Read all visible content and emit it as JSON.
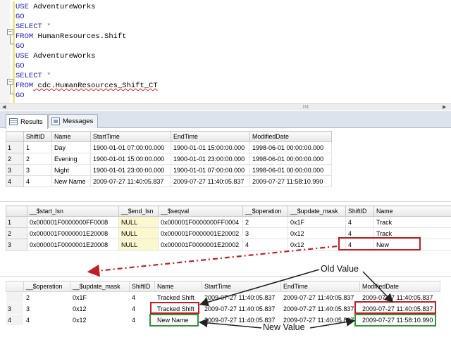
{
  "editor": {
    "lines": [
      {
        "kw": "USE",
        "rest": " AdventureWorks"
      },
      {
        "kw": "GO",
        "rest": ""
      },
      {
        "kw": "SELECT",
        "rest": " *",
        "rest_gray": true
      },
      {
        "kw": "FROM",
        "rest": " HumanResources.Shift"
      },
      {
        "kw": "GO",
        "rest": ""
      },
      {
        "kw": "USE",
        "rest": " AdventureWorks"
      },
      {
        "kw": "GO",
        "rest": ""
      },
      {
        "kw": "SELECT",
        "rest": " *",
        "rest_gray": true
      },
      {
        "kw": "FROM",
        "rest": " cdc.HumanResources_Shift_CT",
        "squiggle": true
      },
      {
        "kw": "GO",
        "rest": ""
      }
    ],
    "scroll_grip": "III"
  },
  "tabs": {
    "results": "Results",
    "messages": "Messages"
  },
  "grid1": {
    "columns": [
      "ShiftID",
      "Name",
      "StartTime",
      "EndTime",
      "ModifiedDate"
    ],
    "rows": [
      {
        "n": "1",
        "cells": [
          "1",
          "Day",
          "1900-01-01 07:00:00.000",
          "1900-01-01 15:00:00.000",
          "1998-06-01 00:00:00.000"
        ]
      },
      {
        "n": "2",
        "cells": [
          "2",
          "Evening",
          "1900-01-01 15:00:00.000",
          "1900-01-01 23:00:00.000",
          "1998-06-01 00:00:00.000"
        ]
      },
      {
        "n": "3",
        "cells": [
          "3",
          "Night",
          "1900-01-01 23:00:00.000",
          "1900-01-01 07:00:00.000",
          "1998-06-01 00:00:00.000"
        ]
      },
      {
        "n": "4",
        "cells": [
          "4",
          "New Name",
          "2009-07-27 11:40:05.837",
          "2009-07-27 11:40:05.837",
          "2009-07-27 11:58:10.990"
        ]
      }
    ]
  },
  "grid2": {
    "columns": [
      "__$start_lsn",
      "__$end_lsn",
      "__$seqval",
      "__$operation",
      "__$update_mask",
      "ShiftID",
      "Name"
    ],
    "rows": [
      {
        "n": "1",
        "cells": [
          "0x000001F0000000FF0008",
          "NULL",
          "0x000001F0000000FF0004",
          "2",
          "0x1F",
          "4",
          "Track"
        ]
      },
      {
        "n": "2",
        "cells": [
          "0x000001F0000001E20008",
          "NULL",
          "0x000001F0000001E20002",
          "3",
          "0x12",
          "4",
          "Track"
        ]
      },
      {
        "n": "3",
        "cells": [
          "0x000001F0000001E20008",
          "NULL",
          "0x000001F0000001E20002",
          "4",
          "0x12",
          "4",
          "New"
        ]
      }
    ]
  },
  "grid3": {
    "columns": [
      "__$operation",
      "__$update_mask",
      "ShiftID",
      "Name",
      "StartTime",
      "EndTime",
      "ModifiedDate"
    ],
    "rows": [
      {
        "cells": [
          "2",
          "0x1F",
          "4",
          "Tracked Shift",
          "2009-07-27 11:40:05.837",
          "2009-07-27 11:40:05.837",
          "2009-07-27 11:40:05.837"
        ]
      },
      {
        "n": "3",
        "cells": [
          "3",
          "0x12",
          "4",
          "Tracked Shift",
          "2009-07-27 11:40:05.837",
          "2009-07-27 11:40:05.837",
          "2009-07-27 11:40:05.837"
        ]
      },
      {
        "n": "4",
        "cells": [
          "4",
          "0x12",
          "4",
          "New Name",
          "2009-07-27 11:40:05.837",
          "2009-07-27 11:40:05.837",
          "2009-07-27 11:58:10.990"
        ]
      }
    ]
  },
  "annotations": {
    "old_value": "Old Value",
    "new_value": "New Value"
  },
  "colors": {
    "keyword": "#1e22c8",
    "highlight_red": "#c41e25",
    "highlight_green": "#2f9638",
    "null_cell": "#fbf7cf"
  }
}
